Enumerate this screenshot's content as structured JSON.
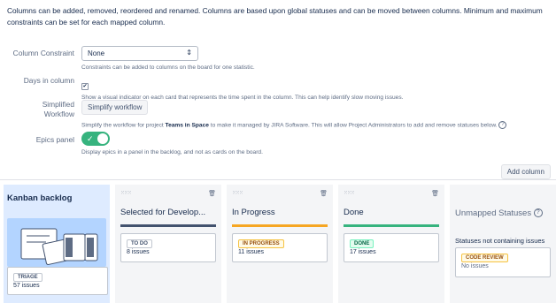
{
  "intro": "Columns can be added, removed, reordered and renamed. Columns are based upon global statuses and can be moved between columns. Minimum and maximum constraints can be set for each mapped column.",
  "constraint": {
    "label": "Column Constraint",
    "value": "None",
    "help": "Constraints can be added to columns on the board for one statistic."
  },
  "days": {
    "label": "Days in column",
    "checked": true,
    "help": "Show a visual indicator on each card that represents the time spent in the column. This can help identify slow moving issues."
  },
  "simplified": {
    "label_line1": "Simplified",
    "label_line2": "Workflow",
    "button": "Simplify workflow",
    "help_prefix": "Simplify the workflow for project ",
    "help_project": "Teams in Space",
    "help_suffix": " to make it managed by JIRA Software. This will allow Project Administrators to add and remove statuses below."
  },
  "epics": {
    "label": "Epics panel",
    "enabled": true,
    "help": "Display epics in a panel in the backlog, and not as cards on the board."
  },
  "add_column": "Add column",
  "columns": {
    "kanban": {
      "title": "Kanban backlog",
      "card": {
        "status": "TRIAGE",
        "count": "57 issues"
      }
    },
    "selected": {
      "title": "Selected for Develop...",
      "card": {
        "status": "TO DO",
        "count": "8 issues"
      },
      "bar_color": "#42526e"
    },
    "progress": {
      "title": "In Progress",
      "card": {
        "status": "IN PROGRESS",
        "count": "11 issues"
      },
      "bar_color": "#f6a623"
    },
    "done": {
      "title": "Done",
      "card": {
        "status": "DONE",
        "count": "17 issues"
      },
      "bar_color": "#36b37e"
    },
    "unmapped": {
      "title": "Unmapped Statuses",
      "subtitle": "Statuses not containing issues",
      "card": {
        "status": "CODE REVIEW",
        "count": "No issues"
      }
    }
  }
}
